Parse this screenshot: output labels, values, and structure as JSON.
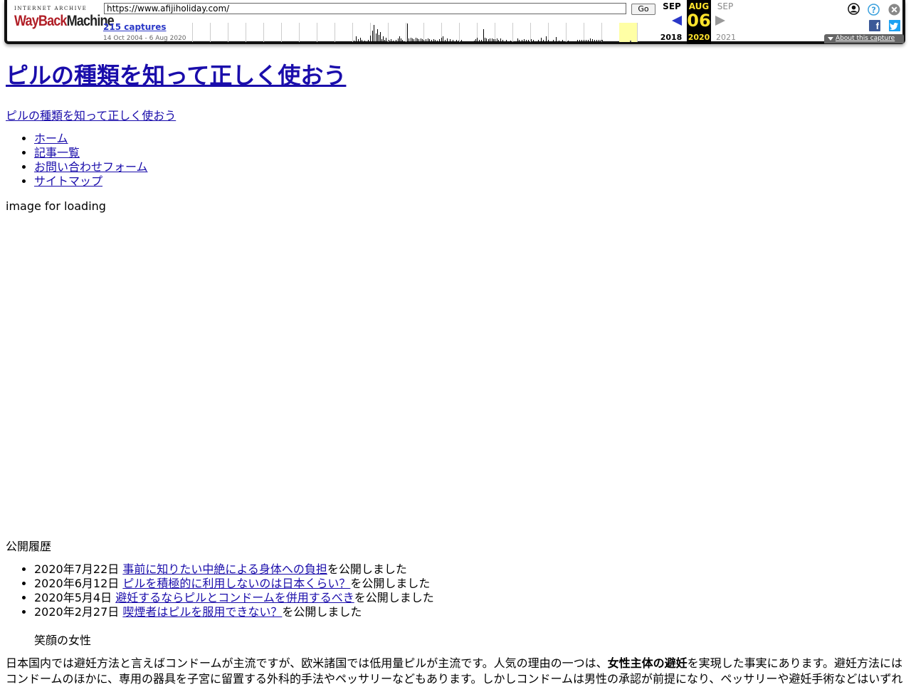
{
  "toolbar": {
    "logo_top": "INTERNET ARCHIVE",
    "logo_wayback": "WayBack",
    "logo_machine": "Machine",
    "url": "https://www.afijiholiday.com/",
    "go_label": "Go",
    "captures": "215 captures",
    "range": "14 Oct 2004 - 6 Aug 2020",
    "prev_month": "SEP",
    "cur_month": "AUG",
    "next_month": "SEP",
    "cur_day": "06",
    "prev_year": "2018",
    "cur_year": "2020",
    "next_year": "2021",
    "about": "About this capture",
    "fb_letter": "f",
    "colors": {
      "accent": "#2a38c7",
      "highlight": "#ffe32c",
      "current_slot": "#ffffa5"
    }
  },
  "site": {
    "title": "ピルの種類を知って正しく使おう",
    "description": "ピルの種類を知って正しく使おう",
    "nav": [
      "ホーム",
      "記事一覧",
      "お問い合わせフォーム",
      "サイトマップ"
    ],
    "loading_alt": "image for loading",
    "history_heading": "公開履歴",
    "history": [
      {
        "date": "2020年7月22日",
        "link": "事前に知りたい中絶による身体への負担",
        "suffix": "を公開しました"
      },
      {
        "date": "2020年6月12日",
        "link": "ピルを積極的に利用しないのは日本くらい？",
        "suffix": "を公開しました"
      },
      {
        "date": "2020年5月4日",
        "link": "避妊するならピルとコンドームを併用するべき",
        "suffix": "を公開しました"
      },
      {
        "date": "2020年2月27日",
        "link": "喫煙者はピルを服用できない？",
        "suffix": "を公開しました"
      }
    ],
    "smile_alt": "笑顔の女性",
    "body_before": "日本国内では避妊方法と言えばコンドームが主流ですが、欧米諸国では低用量ピルが主流です。人気の理由の一つは、",
    "body_bold": "女性主体の避妊",
    "body_after": "を実現した事実にあります。避妊方法にはコンドームのほかに、専用の器具を子宮に留置する外科的手法やペッサリーなどもあります。しかしコンドームは男性の承認が前提になり、ペッサリーや避妊手術などはいずれ"
  }
}
